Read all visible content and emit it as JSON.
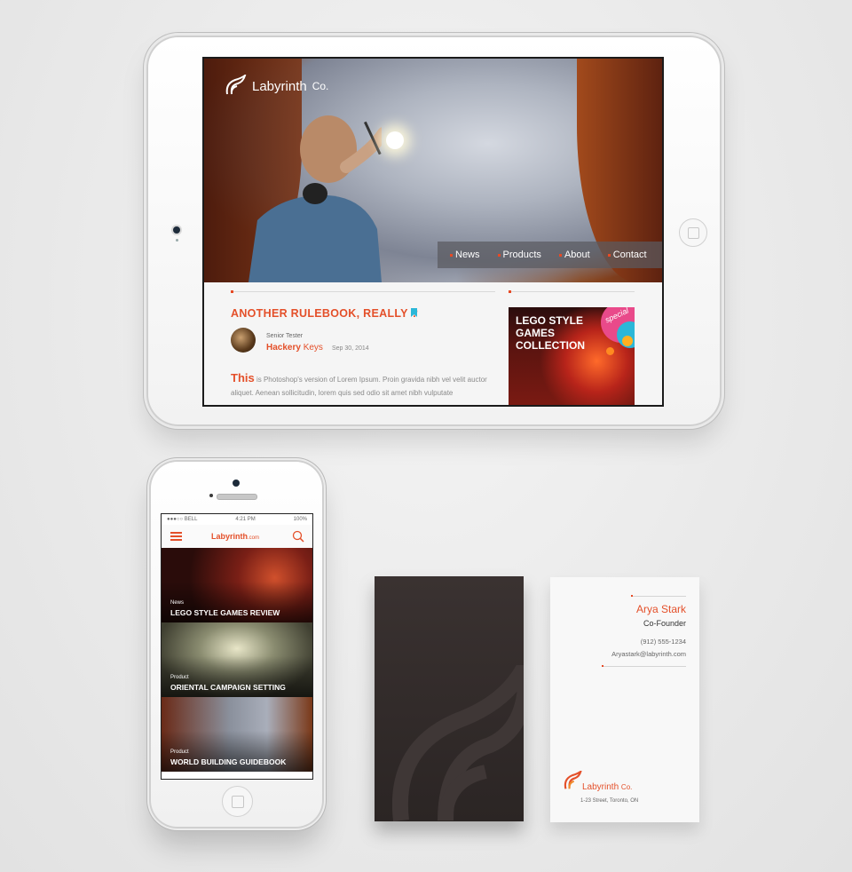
{
  "colors": {
    "accent": "#e4502a",
    "card_dark": "#2f2827",
    "background": "#ebebeb"
  },
  "tablet": {
    "brand": {
      "name": "Labyrinth",
      "suffix": "Co."
    },
    "nav": [
      "News",
      "Products",
      "About",
      "Contact"
    ],
    "article": {
      "title": "ANOTHER RULEBOOK, REALLY ?",
      "author_role": "Senior Tester",
      "author_first": "Hackery",
      "author_last": "Keys",
      "date": "Sep 30, 2014",
      "dropcap": "This",
      "body": "is Photoshop's version  of Lorem Ipsum. Proin gravida nibh vel velit auctor aliquet. Aenean sollicitudin, lorem quis sed odio sit amet nibh vulputate"
    },
    "promo": {
      "text": "LEGO STYLE GAMES COLLECTION",
      "badge": "special"
    }
  },
  "phone": {
    "status": {
      "carrier": "●●●○○ BELL",
      "time": "4:21 PM",
      "battery": "100%"
    },
    "brand": {
      "name": "Labyrinth",
      "suffix": ".com"
    },
    "feed": [
      {
        "category": "News",
        "title": "LEGO STYLE GAMES REVIEW"
      },
      {
        "category": "Product",
        "title": "ORIENTAL CAMPAIGN SETTING"
      },
      {
        "category": "Product",
        "title": "WORLD BUILDING GUIDEBOOK"
      }
    ]
  },
  "business_card": {
    "name": "Arya Stark",
    "title": "Co-Founder",
    "phone": "(912) 555-1234",
    "email": "Aryastark@labyrinth.com",
    "brand": "Labyrinth",
    "brand_suffix": "Co.",
    "address": "1-23 Street, Toronto, ON"
  }
}
